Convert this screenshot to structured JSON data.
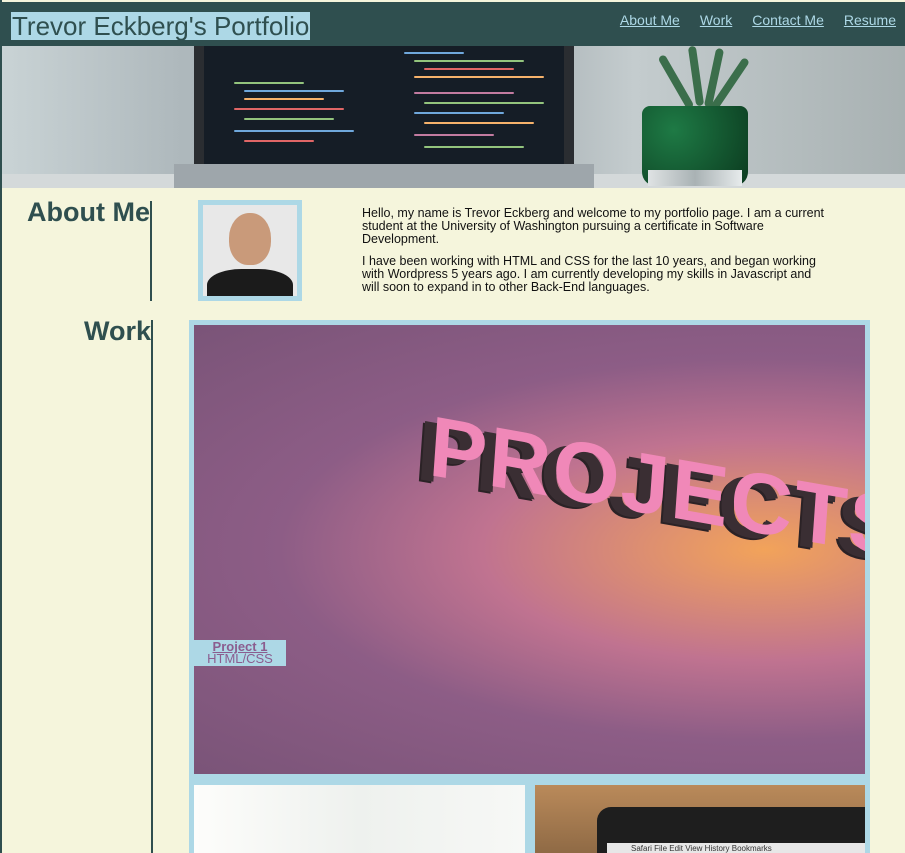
{
  "header": {
    "title": "Trevor Eckberg's Portfolio",
    "nav": [
      "About Me",
      "Work",
      "Contact Me",
      "Resume"
    ]
  },
  "about": {
    "heading": "About Me",
    "paragraphs": [
      "Hello, my name is Trevor Eckberg and welcome to my portfolio page. I am a current student at the University of Washington pursuing a certificate in Software Development.",
      "I have been working with HTML and CSS for the last 10 years, and began working with Wordpress 5 years ago. I am currently developing my skills in Javascript and will soon to expand in to other Back-End languages."
    ]
  },
  "work": {
    "heading": "Work",
    "projects": [
      {
        "image_text": "PROJECTS",
        "title": "Project 1",
        "tech": "HTML/CSS"
      }
    ],
    "menubar_text": "Safari   File   Edit   View   History   Bookmarks"
  },
  "colors": {
    "dark_slate": "#2f4f4f",
    "light_blue": "#add8e6",
    "beige": "#f5f5dc",
    "project_link": "#8b5d8f"
  },
  "icons": {
    "hero": "laptop-code-photo",
    "avatar": "profile-photo"
  }
}
